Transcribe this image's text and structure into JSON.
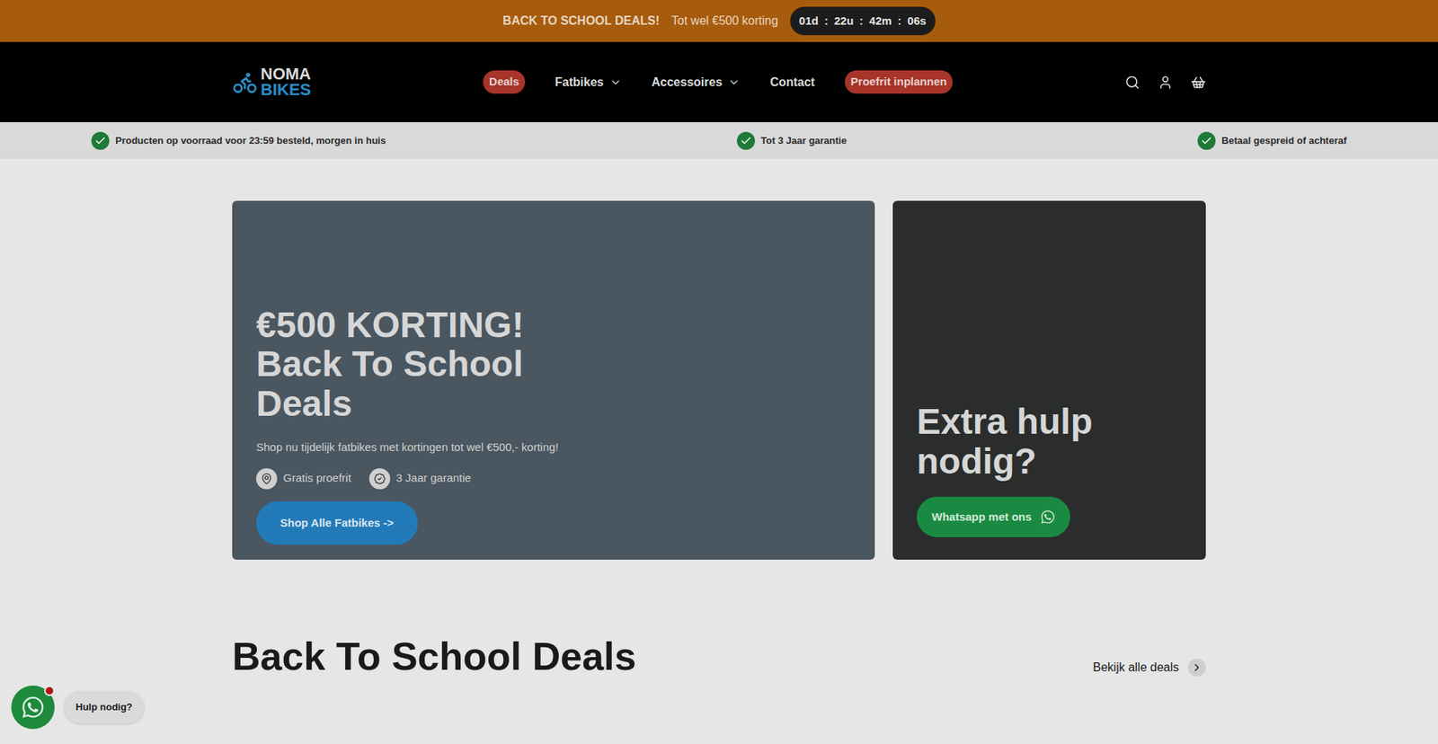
{
  "banner": {
    "title": "BACK TO SCHOOL DEALS!",
    "text": "Tot wel €500 korting",
    "separator": ":",
    "countdown": [
      {
        "value": "01",
        "unit": "d"
      },
      {
        "value": "22",
        "unit": "u"
      },
      {
        "value": "42",
        "unit": "m"
      },
      {
        "value": "06",
        "unit": "s"
      }
    ]
  },
  "header": {
    "logo": {
      "top": "NOMA",
      "bottom": "BIKES"
    },
    "nav": [
      {
        "label": "Deals",
        "kind": "pill"
      },
      {
        "label": "Fatbikes",
        "kind": "dropdown"
      },
      {
        "label": "Accessoires",
        "kind": "dropdown"
      },
      {
        "label": "Contact",
        "kind": "link"
      },
      {
        "label": "Proefrit inplannen",
        "kind": "pill"
      }
    ]
  },
  "trust": [
    "Producten op voorraad voor 23:59 besteld, morgen in huis",
    "Tot 3 Jaar garantie",
    "Betaal gespreid of achteraf"
  ],
  "hero": {
    "title": "€500 KORTING! Back To School Deals",
    "subtitle": "Shop nu tijdelijk fatbikes met kortingen tot wel €500,- korting!",
    "features": [
      {
        "label": "Gratis proefrit",
        "kind": "pin"
      },
      {
        "label": "3 Jaar garantie",
        "kind": "badge"
      }
    ],
    "button": "Shop Alle Fatbikes ->"
  },
  "side": {
    "title": "Extra hulp nodig?",
    "button": "Whatsapp met ons"
  },
  "section": {
    "title": "Back To School Deals",
    "link": "Bekijk alle deals"
  },
  "float": {
    "label": "Hulp nodig?",
    "unread": true
  }
}
